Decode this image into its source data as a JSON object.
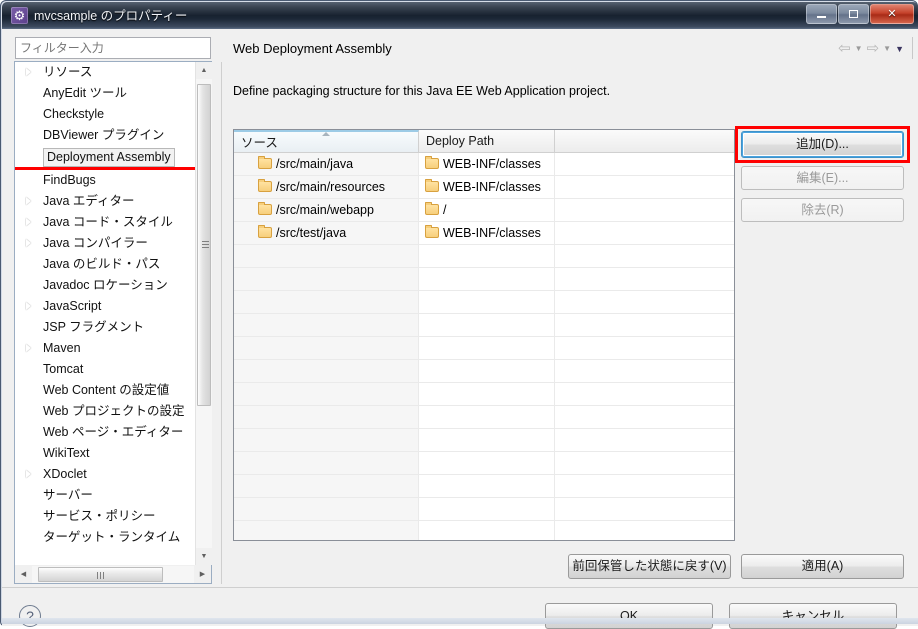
{
  "window": {
    "title": "mvcsample のプロパティー",
    "icon": "gear-icon",
    "controls": {
      "minimize": "−",
      "maximize": "□",
      "close": "✕"
    }
  },
  "sidebar": {
    "filter": {
      "placeholder": "フィルター入力",
      "value": ""
    },
    "items": [
      {
        "label": "リソース",
        "expandable": true,
        "selected": false
      },
      {
        "label": "AnyEdit ツール",
        "expandable": false,
        "selected": false
      },
      {
        "label": "Checkstyle",
        "expandable": false,
        "selected": false
      },
      {
        "label": "DBViewer プラグイン",
        "expandable": false,
        "selected": false
      },
      {
        "label": "Deployment Assembly",
        "expandable": false,
        "selected": true
      },
      {
        "label": "FindBugs",
        "expandable": false,
        "selected": false
      },
      {
        "label": "Java エディター",
        "expandable": true,
        "selected": false
      },
      {
        "label": "Java コード・スタイル",
        "expandable": true,
        "selected": false
      },
      {
        "label": "Java コンパイラー",
        "expandable": true,
        "selected": false
      },
      {
        "label": "Java のビルド・パス",
        "expandable": false,
        "selected": false
      },
      {
        "label": "Javadoc ロケーション",
        "expandable": false,
        "selected": false
      },
      {
        "label": "JavaScript",
        "expandable": true,
        "selected": false
      },
      {
        "label": "JSP フラグメント",
        "expandable": false,
        "selected": false
      },
      {
        "label": "Maven",
        "expandable": true,
        "selected": false
      },
      {
        "label": "Tomcat",
        "expandable": false,
        "selected": false
      },
      {
        "label": "Web Content の設定値",
        "expandable": false,
        "selected": false
      },
      {
        "label": "Web プロジェクトの設定",
        "expandable": false,
        "selected": false
      },
      {
        "label": "Web ページ・エディター",
        "expandable": false,
        "selected": false
      },
      {
        "label": "WikiText",
        "expandable": false,
        "selected": false
      },
      {
        "label": "XDoclet",
        "expandable": true,
        "selected": false
      },
      {
        "label": "サーバー",
        "expandable": false,
        "selected": false
      },
      {
        "label": "サービス・ポリシー",
        "expandable": false,
        "selected": false
      },
      {
        "label": "ターゲット・ランタイム",
        "expandable": false,
        "selected": false
      }
    ]
  },
  "content": {
    "title": "Web Deployment Assembly",
    "description": "Define packaging structure for this Java EE Web Application project.",
    "nav": {
      "back_icon": "arrow-left-icon",
      "back_menu_icon": "chevron-down-icon",
      "forward_icon": "arrow-right-icon",
      "forward_menu_icon": "chevron-down-icon",
      "view_menu_icon": "chevron-down-icon"
    }
  },
  "table": {
    "columns": [
      "ソース",
      "Deploy Path",
      ""
    ],
    "sort_column": "ソース",
    "sort_direction": "ascending",
    "rows": [
      {
        "source": "/src/main/java",
        "deploy_path": "WEB-INF/classes",
        "extra": ""
      },
      {
        "source": "/src/main/resources",
        "deploy_path": "WEB-INF/classes",
        "extra": ""
      },
      {
        "source": "/src/main/webapp",
        "deploy_path": "/",
        "extra": ""
      },
      {
        "source": "/src/test/java",
        "deploy_path": "WEB-INF/classes",
        "extra": ""
      }
    ],
    "empty_row_count": 14
  },
  "side_buttons": {
    "add": "追加(D)...",
    "edit": "編集(E)...",
    "remove": "除去(R)"
  },
  "bottom_buttons": {
    "restore_defaults": "前回保管した状態に戻す(V)",
    "apply": "適用(A)",
    "ok": "OK",
    "cancel": "キャンセル",
    "help_icon": "question-mark-icon"
  },
  "highlight": {
    "color": "#ff0000",
    "target": "追加(D)..."
  }
}
